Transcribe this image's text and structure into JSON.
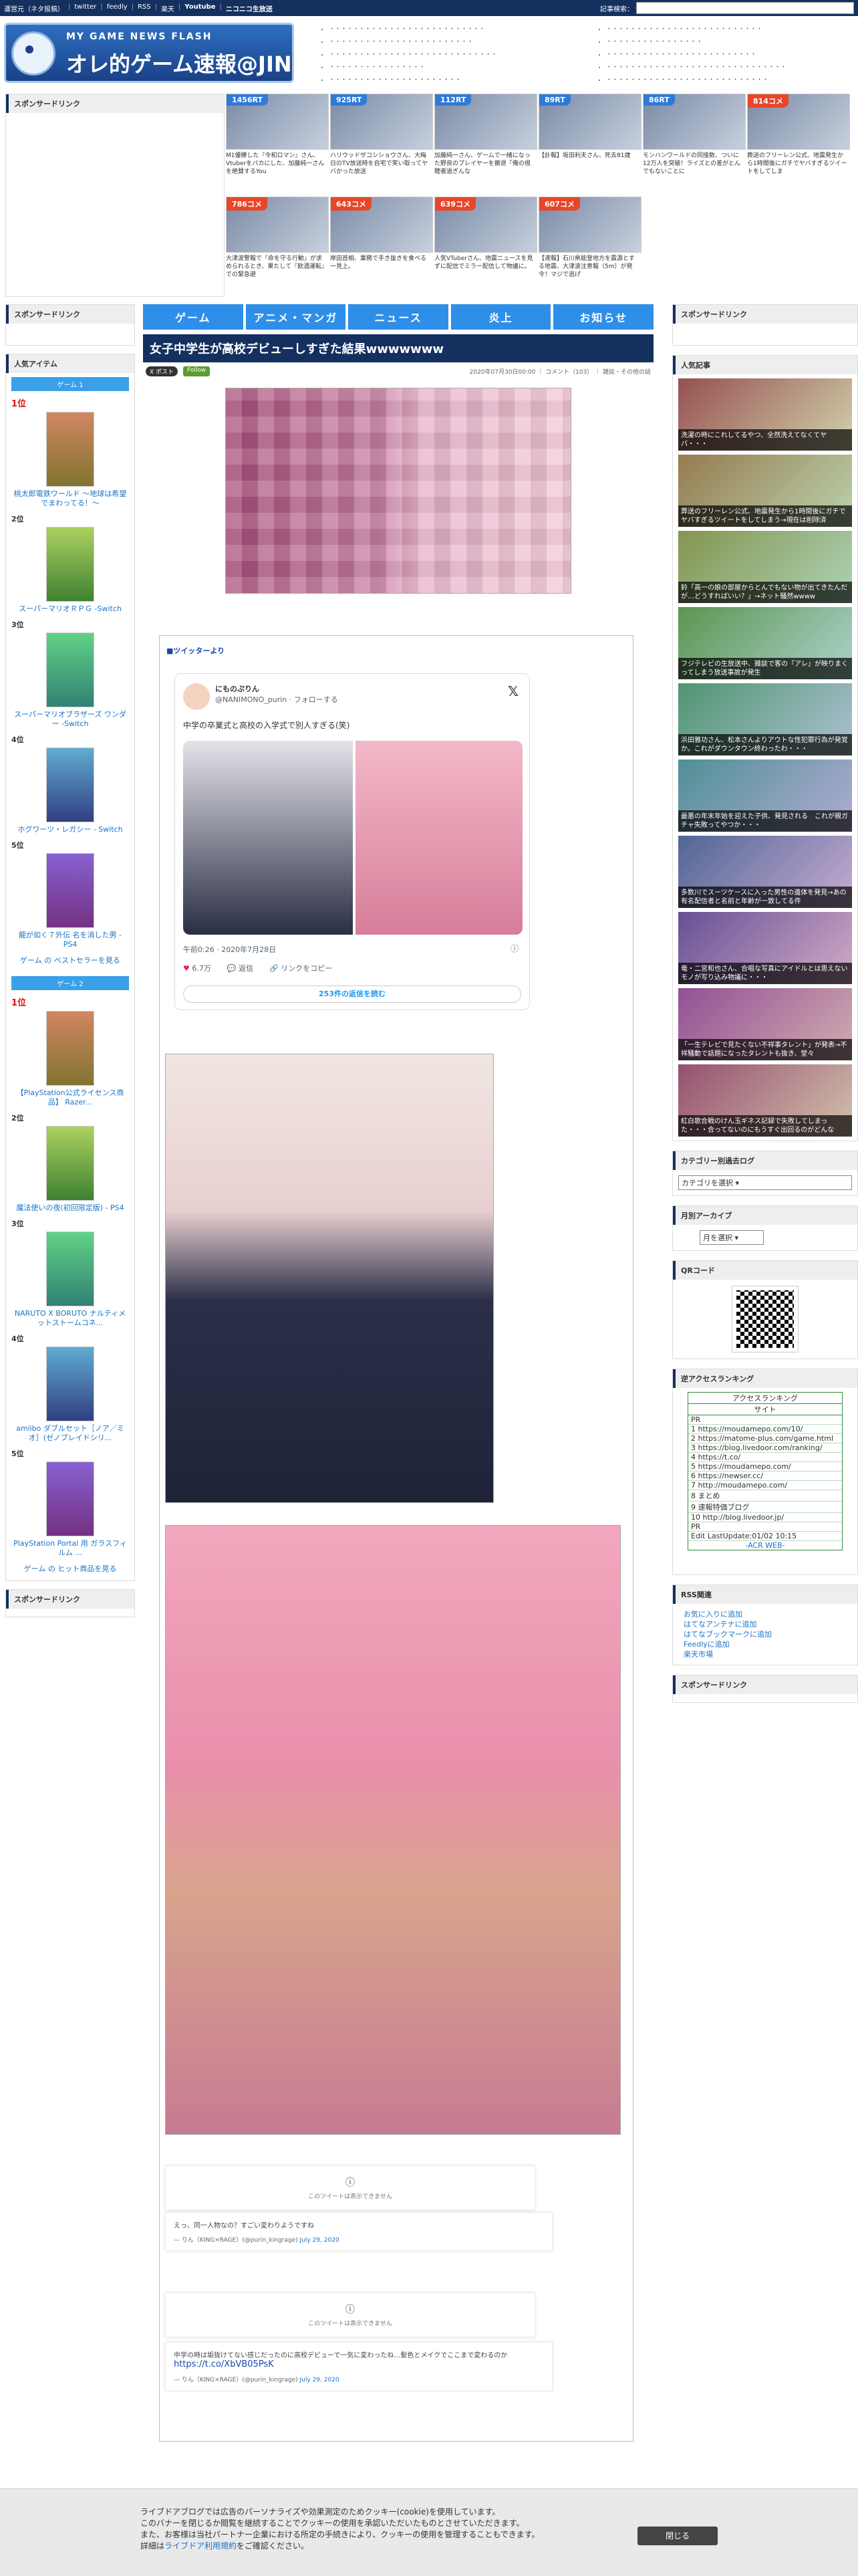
{
  "topbar": {
    "links": [
      "運営元（ネタ投稿）",
      "twitter",
      "feedly",
      "RSS",
      "楽天",
      "Youtube",
      "ニコニコ生放送"
    ],
    "search_label": "記事検索："
  },
  "header": {
    "logo_tagline": "MY GAME NEWS FLASH",
    "logo_name": "オレ的ゲーム速報@JIN"
  },
  "sponsor_left": {
    "title": "スポンサードリンク"
  },
  "thumbs": [
    {
      "badge": "1456RT",
      "caption": "M1優勝した『令和ロマン』さん、Vtuberをバカにした、加藤純一さんを絶賛するYou"
    },
    {
      "badge": "925RT",
      "caption": "ハリウッドザコシショウさん、大晦日のTV放送時を自宅で笑い取ってヤバかった放送"
    },
    {
      "badge": "112RT",
      "caption": "加藤純一さん、ゲームで一緒になった野良のプレイヤーを撤退「俺の視聴者過ぎんな"
    },
    {
      "badge": "89RT",
      "caption": "【訃報】坂田利夫さん、死去81歳"
    },
    {
      "badge": "86RT",
      "caption": "モンハンワールドの同接数、ついに12万人を突破！ライズとの差がとんでもないことに"
    },
    {
      "badge": "814コメ",
      "caption": "葬送のフリーレン公式、地震発生から1時間後にガチでヤバすぎるツイートをしてしま"
    },
    {
      "badge": "786コメ",
      "caption": "大津波警報で『命を守る行動』が求められるとき、果たして『飲酒運転』での緊急避"
    },
    {
      "badge": "643コメ",
      "caption": "岸田首相、業務で手き抜きを食べる一見上。"
    },
    {
      "badge": "639コメ",
      "caption": "人気VTuberさん、地震ニュースを見ずに配信でミラー配信して物議に。"
    },
    {
      "badge": "607コメ",
      "caption": "【速報】石川県能登地方を震源とする地震、大津波注意報（5m）が発令！マジで逃げ"
    }
  ],
  "nav": [
    "ゲーム",
    "アニメ・マンガ",
    "ニュース",
    "炎上",
    "お知らせ"
  ],
  "left": {
    "sponsor_title": "スポンサードリンク",
    "popular_title": "人気アイテム",
    "game1_head": "ゲーム 1",
    "game1": [
      {
        "pos": "1位",
        "name": "桃太郎電鉄ワールド ～地球は希望でまわってる！～"
      },
      {
        "pos": "2位",
        "name": "スーパーマリオＲＰＧ -Switch"
      },
      {
        "pos": "3位",
        "name": "スーパーマリオブラザーズ ワンダー -Switch"
      },
      {
        "pos": "4位",
        "name": "ホグワーツ・レガシー - Switch"
      },
      {
        "pos": "5位",
        "name": "龍が如く７外伝 名を消した男 - PS4"
      }
    ],
    "game1_more": "ゲーム の ベストセラーを見る",
    "game2_head": "ゲーム 2",
    "game2": [
      {
        "pos": "1位",
        "name": "【PlayStation公式ライセンス商品】 Razer..."
      },
      {
        "pos": "2位",
        "name": "魔法使いの夜(初回限定版) - PS4"
      },
      {
        "pos": "3位",
        "name": "NARUTO X BORUTO ナルティメットストームコネ..."
      },
      {
        "pos": "4位",
        "name": "amiibo ダブルセット［ノア／ミオ］(ゼノブレイドシリ..."
      },
      {
        "pos": "5位",
        "name": "PlayStation Portal 用 ガラスフィルム ..."
      }
    ],
    "game2_more": "ゲーム の ヒット商品を見る",
    "sponsor2_title": "スポンサードリンク"
  },
  "article": {
    "title": "女子中学生が高校デビューしすぎた結果wwwwwww",
    "x_btn": "X ポスト",
    "follow_btn": "Follow",
    "meta": "2020年07月30日00:00 ｜ コメント（103） ｜ 雑談・その他の話",
    "twitter_label": "■ツイッターより",
    "tweet": {
      "name": "にものぷりん",
      "handle": "@NANIMONO_purin · フォローする",
      "text": "中学の卒業式と高校の入学式で別人すぎる(笑)",
      "time": "午前0:26 · 2020年7月28日",
      "likes": "6.7万",
      "reply": "返信",
      "share": "リンクをコピー",
      "more": "253件の返信を読む"
    },
    "embed1_label": "このツイートは表示できません",
    "quote1_text": "えっ、同一人物なの？すごい変わりようですね",
    "quote1_by": "— りん（KING×RAGE）(@purin_kingrage)",
    "quote1_date": "July 29, 2020",
    "embed2_label": "このツイートは表示できません",
    "quote2_text": "中学の時は垢抜けてない感じだったのに高校デビューで一気に変わったね…髪色とメイクでここまで変わるのか",
    "quote2_link": "https://t.co/XbVB05PsK",
    "quote2_by": "— りん（KING×RAGE）(@purin_kingrage)",
    "quote2_date": "July 29, 2020"
  },
  "right": {
    "sponsor_title": "スポンサードリンク",
    "popular_title": "人気記事",
    "popular": [
      "洗濯の時にこれしてるやつ、全然洗えてなくてヤバ・・・",
      "葬送のフリーレン公式、地震発生から1時間後にガチでヤバすぎるツイートをしてしまう→現在は削除済",
      "鈴「高一の娘の部屋からとんでもない物が出てきたんだが…どうすればいい？」→ネット騒然wwww",
      "フジテレビの生放送中、雑談で客の『アレ』が映りまくってしまう放送事故が発生",
      "浜田雅功さん、松本さんよりアウトな性犯罪行為が発覚か。これがダウンタウン終わったわ・・・",
      "最悪の年末年始を迎えた子供、発見される　これが親ガチャ失敗ってやつか・・・",
      "多数川でスーツケースに入った男性の遺体を発見→あの有名配信者と名前と年齢が一致してる件",
      "竜・二宮和也さん、合唱な写真にアイドルとは思えないモノが写り込み物議に・・・",
      "「一生テレビで見たくない不祥事タレント」が発表→不祥騒動で話題になったタレントも抜き、堂々",
      "紅白歌合戦のけん玉ギネス記録で失敗してしまった・・・合ってないのにもうすぐ出回るのがどんな"
    ],
    "category_title": "カテゴリー別過去ログ",
    "category_select": "カテゴリを選択",
    "archive_title": "月別アーカイブ",
    "archive_select": "月を選択",
    "qr_title": "QRコード",
    "access_title": "逆アクセスランキング",
    "access_head": "アクセスランキング",
    "access_subhead": "サイト",
    "access_rows": [
      "PR",
      "1 https://moudamepo.com/10/",
      "2 https://matome-plus.com/game.html",
      "3 https://blog.livedoor.com/ranking/",
      "4 https://t.co/",
      "5 https://moudamepo.com/",
      "6 https://newser.cc/",
      "7 http://moudamepo.com/",
      "8 まとめ",
      "9 速報特価ブログ",
      "10 http://blog.livedoor.jp/",
      "PR",
      "Edit LastUpdate:01/02 10:15"
    ],
    "access_foot": "-ACR WEB-",
    "rss_title": "RSS関連",
    "rss": [
      "お気に入りに追加",
      "はてなアンテナに追加",
      "はてなブックマークに追加",
      "Feedlyに追加",
      "楽天市場"
    ],
    "sponsor2_title": "スポンサードリンク"
  },
  "cookie": {
    "line1": "ライブドアブログでは広告のパーソナライズや効果測定のためクッキー(cookie)を使用しています。",
    "line2": "このバナーを閉じるか閲覧を継続することでクッキーの使用を承認いただいたものとさせていただきます。",
    "line3": "また、お客様は当社パートナー企業における所定の手続きにより、クッキーの使用を管理することもできます。",
    "line4_pre": "詳細は",
    "line4_link": "ライブドア利用規約",
    "line4_post": "をご確認ください。",
    "close": "閉じる"
  }
}
